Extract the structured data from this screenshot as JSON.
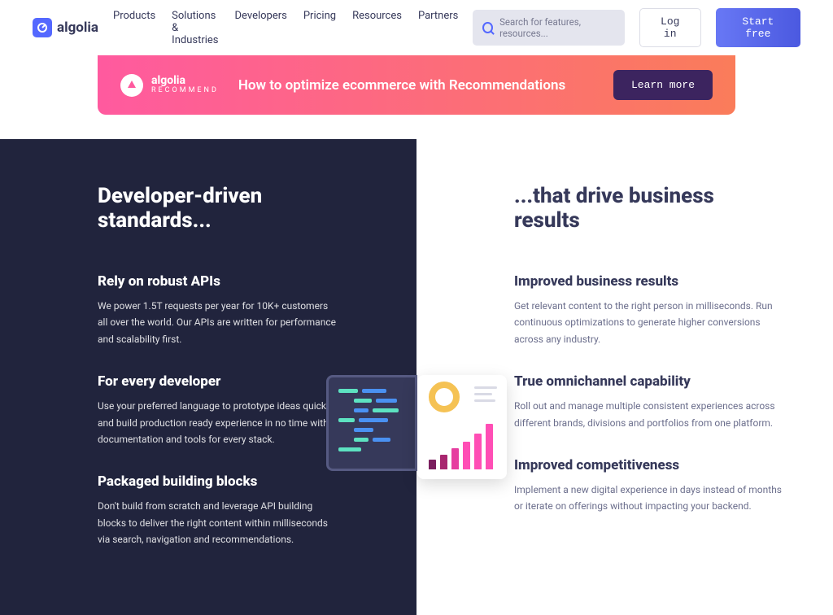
{
  "brand": "algolia",
  "nav": [
    "Products",
    "Solutions & Industries",
    "Developers",
    "Pricing",
    "Resources",
    "Partners"
  ],
  "search": {
    "placeholder": "Search for features, resources..."
  },
  "login": "Log in",
  "start": "Start free",
  "banner": {
    "brand": "algolia",
    "sub": "RECOMMEND",
    "text": "How to optimize ecommerce with Recommendations",
    "cta": "Learn more"
  },
  "left": {
    "title": "Developer-driven standards...",
    "features": [
      {
        "title": "Rely on robust APIs",
        "body": "We power 1.5T requests per year for 10K+ customers all over the world. Our APIs are written for performance and scalability first."
      },
      {
        "title": "For every developer",
        "body": "Use your preferred language to prototype ideas quickly and build production ready experience in no time with documentation and tools for every stack."
      },
      {
        "title": "Packaged building blocks",
        "body": "Don't build from scratch and leverage API building blocks to deliver the right content within milliseconds via search, navigation and recommendations."
      }
    ]
  },
  "right": {
    "title": "...that drive business results",
    "features": [
      {
        "title": "Improved business results",
        "body": "Get relevant content to the right person in milliseconds. Run continuous optimizations to generate higher conversions across any industry."
      },
      {
        "title": "True omnichannel capability",
        "body": "Roll out and manage multiple consistent experiences across different brands, divisions and portfolios from one platform."
      },
      {
        "title": "Improved competitiveness",
        "body": "Implement a new digital experience in days instead of months or iterate on offerings without impacting your backend."
      }
    ]
  }
}
